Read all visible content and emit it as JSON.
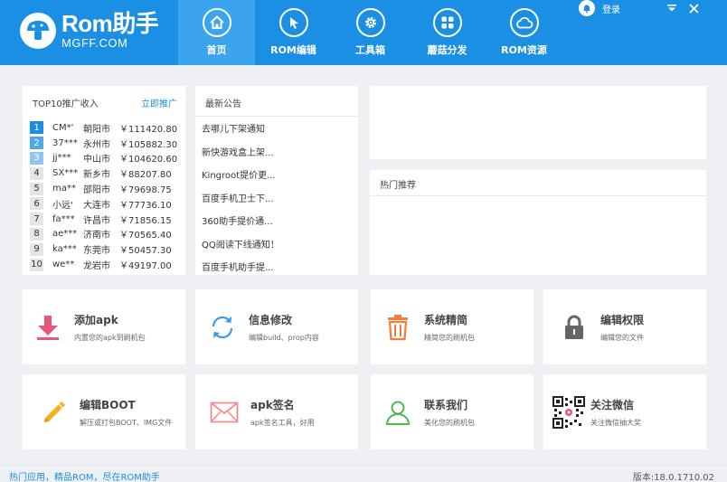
{
  "app": {
    "logo_main": "Rom助手",
    "logo_sub": "MGFF.COM"
  },
  "nav": [
    {
      "label": "首页",
      "icon": "home-icon",
      "active": true
    },
    {
      "label": "ROM编辑",
      "icon": "cursor-icon",
      "active": false
    },
    {
      "label": "工具箱",
      "icon": "gear-icon",
      "active": false
    },
    {
      "label": "蘑菇分发",
      "icon": "grid-icon",
      "active": false
    },
    {
      "label": "ROM资源",
      "icon": "cloud-icon",
      "active": false
    }
  ],
  "header": {
    "login_label": "登录"
  },
  "top10": {
    "title": "TOP10推广收入",
    "link": "立即推广",
    "rows": [
      {
        "rank": "1",
        "user": "CM*'",
        "city": "朝阳市",
        "amount": "￥111420.80"
      },
      {
        "rank": "2",
        "user": "37***",
        "city": "永州市",
        "amount": "￥105882.30"
      },
      {
        "rank": "3",
        "user": "jj***",
        "city": "中山市",
        "amount": "￥104620.60"
      },
      {
        "rank": "4",
        "user": "SX***",
        "city": "新乡市",
        "amount": "￥88207.80"
      },
      {
        "rank": "5",
        "user": "ma**",
        "city": "邵阳市",
        "amount": "￥79698.75"
      },
      {
        "rank": "6",
        "user": "小远'",
        "city": "大连市",
        "amount": "￥77736.10"
      },
      {
        "rank": "7",
        "user": "fa***",
        "city": "许昌市",
        "amount": "￥71856.15"
      },
      {
        "rank": "8",
        "user": "ae***",
        "city": "济南市",
        "amount": "￥70565.40"
      },
      {
        "rank": "9",
        "user": "ka***",
        "city": "东莞市",
        "amount": "￥50457.30"
      },
      {
        "rank": "10",
        "user": "we**",
        "city": "龙岩市",
        "amount": "￥49197.00"
      }
    ]
  },
  "notices": {
    "title": "最新公告",
    "items": [
      "去哪儿下架通知",
      "新快游戏盒上架...",
      "Kingroot提价更...",
      "百度手机卫士下...",
      "360助手提价通...",
      "QQ阅读下线通知！",
      "百度手机助手提..."
    ]
  },
  "hot": {
    "title": "热门推荐"
  },
  "tools": [
    {
      "title": "添加apk",
      "desc": "内置您的apk到刷机包",
      "icon": "download-icon"
    },
    {
      "title": "信息修改",
      "desc": "编辑build、prop内容",
      "icon": "refresh-icon"
    },
    {
      "title": "系统精简",
      "desc": "精简您的刷机包",
      "icon": "trash-icon"
    },
    {
      "title": "编辑权限",
      "desc": "编辑您的文件",
      "icon": "lock-icon"
    },
    {
      "title": "编辑BOOT",
      "desc": "解压或打包BOOT、IMG文件",
      "icon": "pencil-icon"
    },
    {
      "title": "apk签名",
      "desc": "apk签名工具，好用",
      "icon": "envelope-icon"
    },
    {
      "title": "联系我们",
      "desc": "美化您的刷机包",
      "icon": "user-icon"
    },
    {
      "title": "关注微信",
      "desc": "关注微信抽大奖",
      "icon": "qr-code-icon"
    }
  ],
  "footer": {
    "left": "热门应用，精品ROM，尽在ROM助手",
    "right": "版本:18.0.1710.02"
  },
  "colors": {
    "primary": "#1a8fe3",
    "nav_active": "#3ba4ee",
    "download": "#e8567c",
    "refresh": "#3b9ae6",
    "trash": "#f07c3e",
    "lock": "#666666",
    "pencil": "#f2b21b",
    "envelope": "#ef8f8f",
    "user": "#4cb94e"
  }
}
